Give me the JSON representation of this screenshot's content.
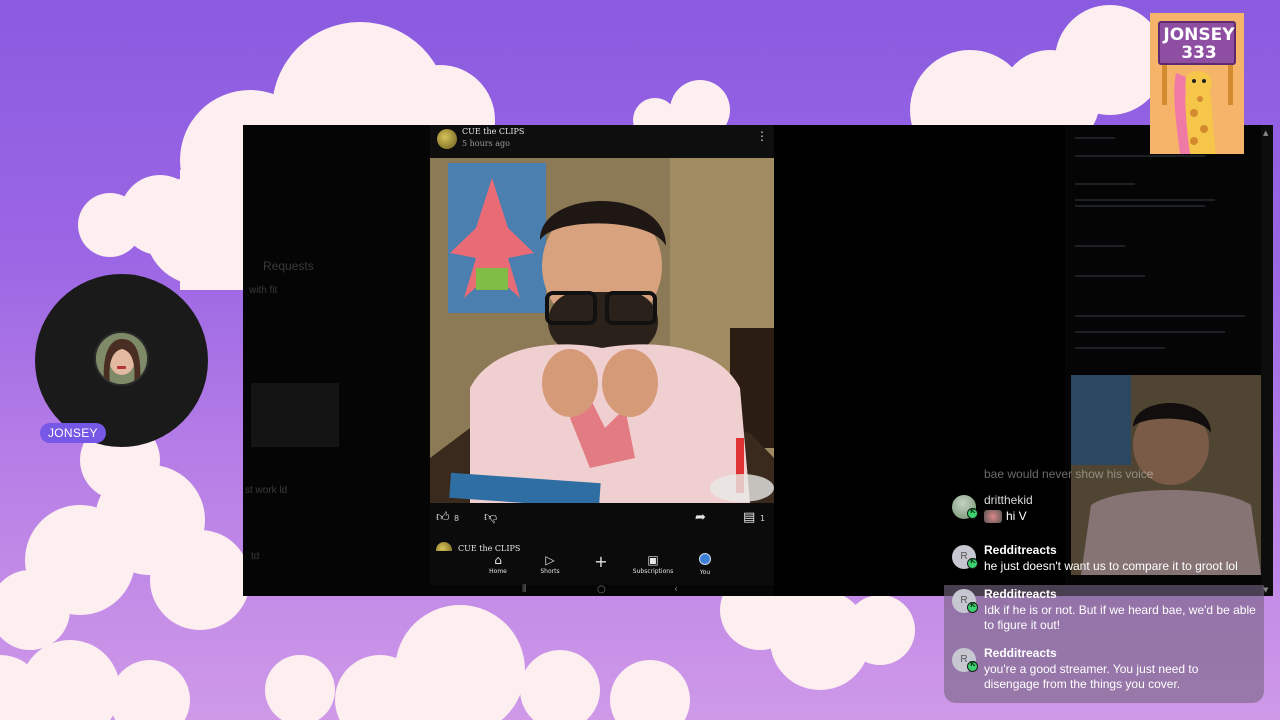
{
  "streamer": {
    "name_tag": "JONSEY",
    "badge_line1": "JONSEY",
    "badge_line2": "333"
  },
  "capture": {
    "left_panel": {
      "faint_label": "Requests",
      "faint_row1": "with     fit",
      "faint_row2": "st work    ld",
      "faint_row3": "td"
    },
    "post": {
      "channel": "CUE the CLIPS",
      "time": "5 hours ago",
      "like_count": "8",
      "comment_count": "1"
    },
    "next_post": {
      "channel": "CUE the CLIPS"
    },
    "nav": [
      {
        "label": "Home",
        "icon": "⌂"
      },
      {
        "label": "Shorts",
        "icon": "▷"
      },
      {
        "label": "",
        "icon": "+"
      },
      {
        "label": "Subscriptions",
        "icon": "▣"
      },
      {
        "label": "You",
        "icon": ""
      }
    ]
  },
  "chat": {
    "ghost_message": "bae would never show his voice",
    "messages": [
      {
        "user": "dritthekid",
        "text": "hi V",
        "avatar": ""
      },
      {
        "user": "Redditreacts",
        "text": "he just doesn't want us to compare it to groot lol",
        "avatar": "R"
      },
      {
        "user": "Redditreacts",
        "text": "Idk if he is or not. But if we heard bae, we'd be able to figure it out!",
        "avatar": "R"
      },
      {
        "user": "Redditreacts",
        "text": "you're a good streamer. You just need to disengage from the things you cover.",
        "avatar": "R"
      }
    ]
  },
  "colors": {
    "background": "#9b66e4",
    "name_pill": "#7657e6",
    "kick_green": "#3bd16f"
  }
}
